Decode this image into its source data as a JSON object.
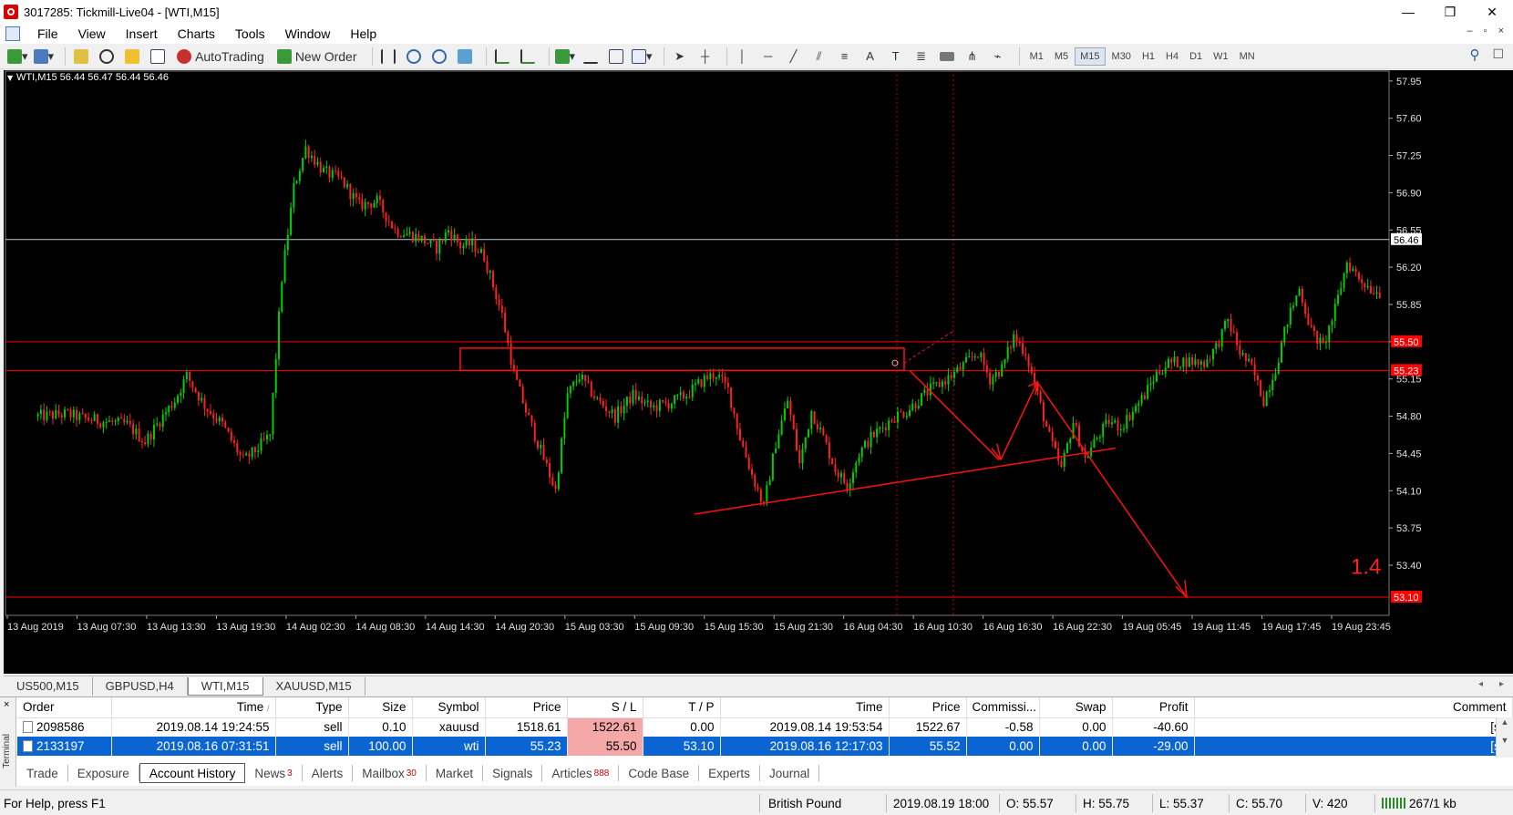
{
  "window": {
    "title": "3017285: Tickmill-Live04 - [WTI,M15]",
    "controls": [
      "—",
      "❐",
      "✕"
    ]
  },
  "menu": [
    "File",
    "View",
    "Insert",
    "Charts",
    "Tools",
    "Window",
    "Help"
  ],
  "mdi_controls": [
    "–",
    "▫",
    "×"
  ],
  "toolbar": {
    "autotrading": "AutoTrading",
    "new_order": "New Order",
    "timeframes": [
      "M1",
      "M5",
      "M15",
      "M30",
      "H1",
      "H4",
      "D1",
      "W1",
      "MN"
    ],
    "active_timeframe": "M15"
  },
  "chart_data": {
    "type": "candlestick",
    "symbol_header": "WTI,M15  56.44 56.47 56.44 56.46",
    "y_ticks": [
      "57.95",
      "57.60",
      "57.25",
      "56.90",
      "56.55",
      "56.20",
      "55.85",
      "55.50",
      "55.15",
      "54.80",
      "54.45",
      "54.10",
      "53.75",
      "53.40"
    ],
    "ylim": [
      53.1,
      58.0
    ],
    "x_labels": [
      "13 Aug 2019",
      "13 Aug 07:30",
      "13 Aug 13:30",
      "13 Aug 19:30",
      "14 Aug 02:30",
      "14 Aug 08:30",
      "14 Aug 14:30",
      "14 Aug 20:30",
      "15 Aug 03:30",
      "15 Aug 09:30",
      "15 Aug 15:30",
      "15 Aug 21:30",
      "16 Aug 04:30",
      "16 Aug 10:30",
      "16 Aug 16:30",
      "16 Aug 22:30",
      "19 Aug 05:45",
      "19 Aug 11:45",
      "19 Aug 17:45",
      "19 Aug 23:45"
    ],
    "price_labels": [
      {
        "value": 56.46,
        "text": "56.46",
        "style": "bid"
      },
      {
        "value": 55.5,
        "text": "55.50",
        "style": "red"
      },
      {
        "value": 55.23,
        "text": "55.23",
        "style": "red"
      },
      {
        "value": 53.1,
        "text": "53.10",
        "style": "red"
      }
    ],
    "annotation_text": "1.4",
    "colors": {
      "up": "#00d000",
      "down": "#ff2020",
      "grid_red": "#ff0000",
      "bid": "#b8c8d8"
    },
    "price_path": [
      [
        54.8,
        10
      ],
      [
        54.82,
        20
      ],
      [
        54.78,
        25
      ],
      [
        54.76,
        30
      ],
      [
        54.72,
        40
      ],
      [
        54.56,
        46
      ],
      [
        54.8,
        52
      ],
      [
        54.95,
        56
      ],
      [
        55.18,
        60
      ],
      [
        54.9,
        66
      ],
      [
        54.72,
        72
      ],
      [
        54.38,
        79
      ],
      [
        54.5,
        84
      ],
      [
        54.62,
        88
      ],
      [
        56.1,
        92
      ],
      [
        56.95,
        96
      ],
      [
        57.32,
        100
      ],
      [
        57.1,
        106
      ],
      [
        57.02,
        112
      ],
      [
        56.78,
        118
      ],
      [
        56.82,
        124
      ],
      [
        56.55,
        130
      ],
      [
        56.48,
        138
      ],
      [
        56.38,
        144
      ],
      [
        56.55,
        148
      ],
      [
        56.4,
        152
      ],
      [
        56.42,
        156
      ],
      [
        56.3,
        160
      ],
      [
        55.75,
        166
      ],
      [
        55.2,
        170
      ],
      [
        54.85,
        174
      ],
      [
        54.4,
        180
      ],
      [
        54.1,
        184
      ],
      [
        55.0,
        188
      ],
      [
        55.18,
        192
      ],
      [
        54.95,
        198
      ],
      [
        54.8,
        204
      ],
      [
        55.0,
        210
      ],
      [
        54.88,
        216
      ],
      [
        54.92,
        222
      ],
      [
        55.0,
        228
      ],
      [
        55.15,
        234
      ],
      [
        55.2,
        238
      ],
      [
        55.05,
        242
      ],
      [
        54.6,
        246
      ],
      [
        54.25,
        250
      ],
      [
        53.95,
        254
      ],
      [
        54.55,
        258
      ],
      [
        54.95,
        262
      ],
      [
        54.35,
        266
      ],
      [
        54.85,
        270
      ],
      [
        54.6,
        274
      ],
      [
        54.3,
        278
      ],
      [
        54.15,
        282
      ],
      [
        54.45,
        286
      ],
      [
        54.6,
        290
      ],
      [
        54.7,
        294
      ],
      [
        54.8,
        298
      ],
      [
        54.85,
        302
      ],
      [
        54.95,
        306
      ],
      [
        55.05,
        310
      ],
      [
        55.12,
        314
      ],
      [
        55.2,
        318
      ],
      [
        55.3,
        322
      ],
      [
        55.4,
        326
      ],
      [
        55.15,
        330
      ],
      [
        55.25,
        334
      ],
      [
        55.55,
        338
      ],
      [
        55.4,
        342
      ],
      [
        55.0,
        346
      ],
      [
        54.6,
        350
      ],
      [
        54.3,
        354
      ],
      [
        54.75,
        358
      ],
      [
        54.4,
        362
      ],
      [
        54.6,
        366
      ],
      [
        54.75,
        370
      ],
      [
        54.7,
        374
      ],
      [
        54.85,
        378
      ],
      [
        55.0,
        382
      ],
      [
        55.2,
        386
      ],
      [
        55.3,
        390
      ],
      [
        55.32,
        396
      ],
      [
        55.3,
        402
      ],
      [
        55.45,
        406
      ],
      [
        55.7,
        410
      ],
      [
        55.4,
        414
      ],
      [
        55.25,
        418
      ],
      [
        54.95,
        422
      ],
      [
        55.25,
        426
      ],
      [
        55.7,
        430
      ],
      [
        56.0,
        434
      ],
      [
        55.6,
        438
      ],
      [
        55.45,
        442
      ],
      [
        55.8,
        446
      ],
      [
        56.25,
        450
      ],
      [
        56.1,
        454
      ],
      [
        56.0,
        458
      ],
      [
        55.95,
        462
      ]
    ]
  },
  "chart_tabs": [
    "US500,M15",
    "GBPUSD,H4",
    "WTI,M15",
    "XAUUSD,M15"
  ],
  "active_chart_tab": "WTI,M15",
  "terminal": {
    "side_label": "Terminal",
    "close": "×",
    "columns": [
      "Order",
      "Time",
      "Type",
      "Size",
      "Symbol",
      "Price",
      "S / L",
      "T / P",
      "Time",
      "Price",
      "Commissi...",
      "Swap",
      "Profit",
      "Comment"
    ],
    "rows": [
      {
        "order": "2098586",
        "time": "2019.08.14 19:24:55",
        "type": "sell",
        "size": "0.10",
        "symbol": "xauusd",
        "price": "1518.61",
        "sl": "1522.61",
        "tp": "0.00",
        "close_time": "2019.08.14 19:53:54",
        "close_price": "1522.67",
        "commission": "-0.58",
        "swap": "0.00",
        "profit": "-40.60",
        "comment": "[sl]"
      },
      {
        "order": "2133197",
        "time": "2019.08.16 07:31:51",
        "type": "sell",
        "size": "100.00",
        "symbol": "wti",
        "price": "55.23",
        "sl": "55.50",
        "tp": "53.10",
        "close_time": "2019.08.16 12:17:03",
        "close_price": "55.52",
        "commission": "0.00",
        "swap": "0.00",
        "profit": "-29.00",
        "comment": "[sl]"
      }
    ],
    "tabs": [
      {
        "label": "Trade",
        "badge": ""
      },
      {
        "label": "Exposure",
        "badge": ""
      },
      {
        "label": "Account History",
        "badge": ""
      },
      {
        "label": "News",
        "badge": "3"
      },
      {
        "label": "Alerts",
        "badge": ""
      },
      {
        "label": "Mailbox",
        "badge": "30"
      },
      {
        "label": "Market",
        "badge": ""
      },
      {
        "label": "Signals",
        "badge": ""
      },
      {
        "label": "Articles",
        "badge": "888"
      },
      {
        "label": "Code Base",
        "badge": ""
      },
      {
        "label": "Experts",
        "badge": ""
      },
      {
        "label": "Journal",
        "badge": ""
      }
    ],
    "active_tab": "Account History"
  },
  "status": {
    "help": "For Help, press F1",
    "profile": "British Pound",
    "datetime": "2019.08.19 18:00",
    "open": "O: 55.57",
    "high": "H: 55.75",
    "low": "L: 55.37",
    "close": "C: 55.70",
    "volume": "V: 420",
    "traffic": "267/1 kb"
  }
}
